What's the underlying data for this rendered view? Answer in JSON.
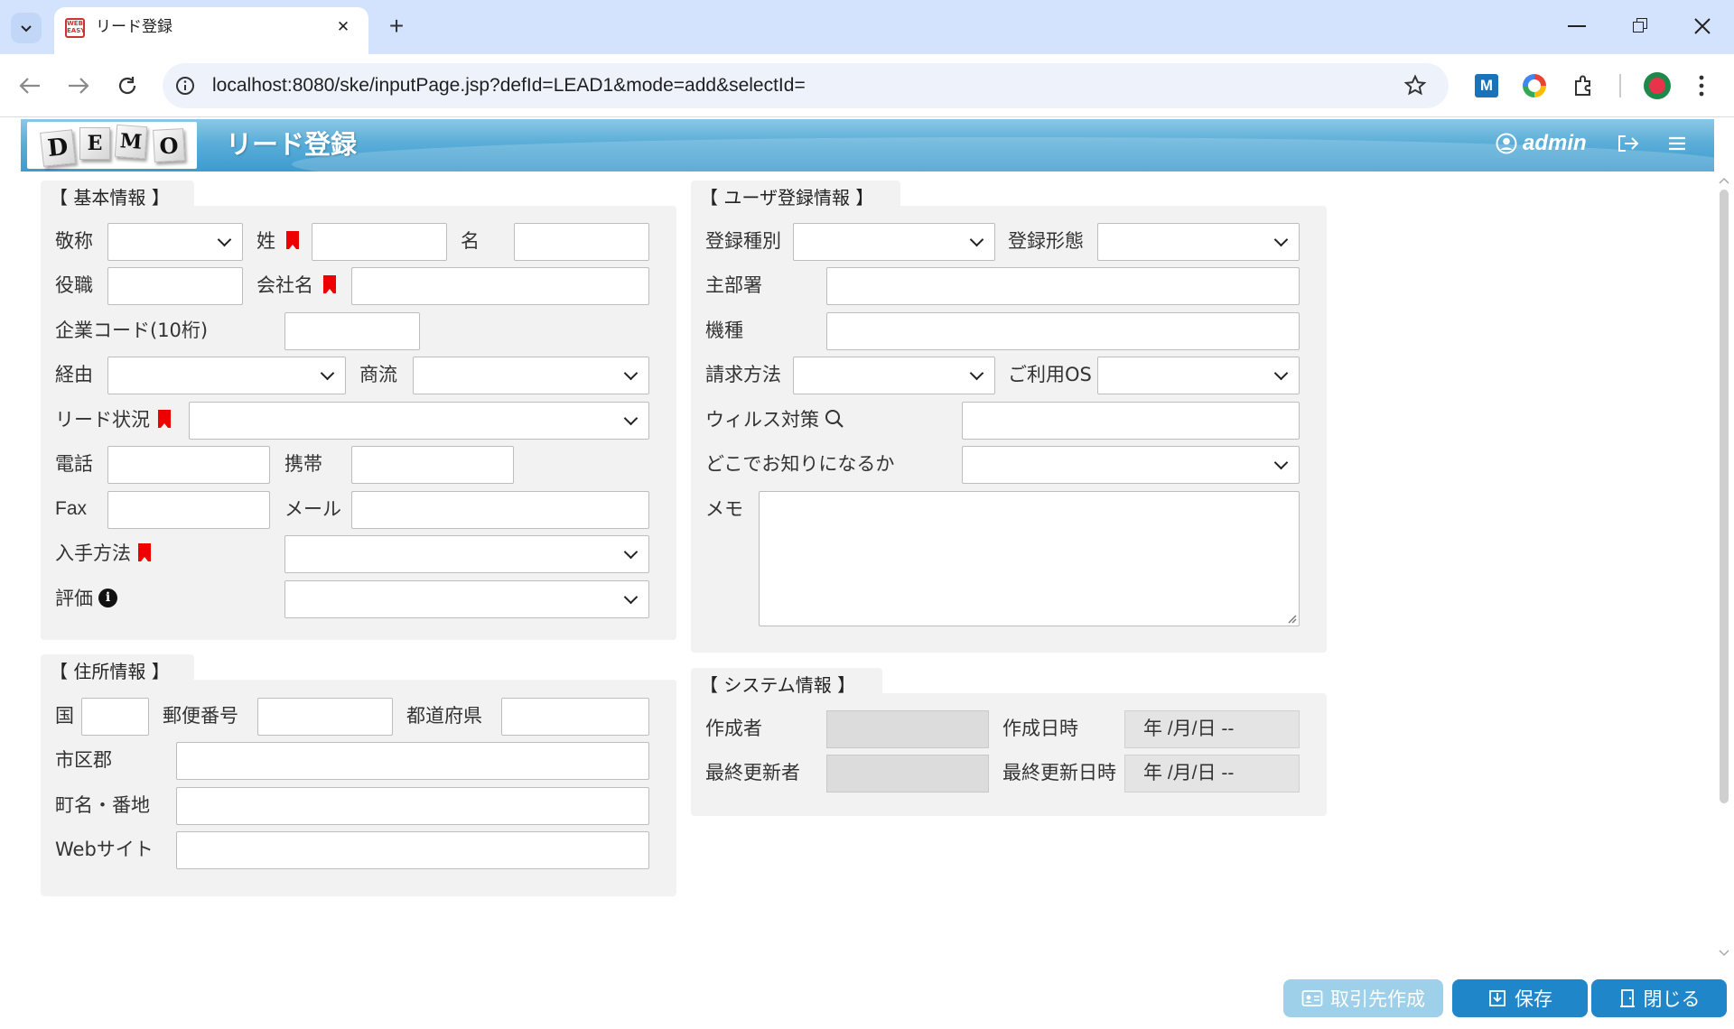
{
  "browser": {
    "tab_title": "リード登録",
    "url": "localhost:8080/ske/inputPage.jsp?defId=LEAD1&mode=add&selectId=",
    "new_tab_symbol": "+",
    "close_symbol": "✕"
  },
  "app": {
    "logo_letters": [
      "D",
      "E",
      "M",
      "O"
    ],
    "title": "リード登録",
    "user": "admin"
  },
  "basic": {
    "heading": "【 基本情報 】",
    "honorific": "敬称",
    "last_name": "姓",
    "first_name": "名",
    "position": "役職",
    "company": "会社名",
    "company_code": "企業コード(10桁)",
    "route": "経由",
    "distribution": "商流",
    "lead_status": "リード状況",
    "phone": "電話",
    "mobile": "携帯",
    "fax": "Fax",
    "mail": "メール",
    "acquisition": "入手方法",
    "rating": "評価",
    "info_glyph": "i"
  },
  "address": {
    "heading": "【 住所情報 】",
    "country": "国",
    "postal": "郵便番号",
    "prefecture": "都道府県",
    "city": "市区郡",
    "street": "町名・番地",
    "website": "Webサイト"
  },
  "user_reg": {
    "heading": "【 ユーザ登録情報 】",
    "reg_type": "登録種別",
    "reg_form": "登録形態",
    "main_dept": "主部署",
    "model": "機種",
    "billing": "請求方法",
    "os": "ご利用OS",
    "antivirus": "ウィルス対策",
    "source": "どこでお知りになるか",
    "memo": "メモ"
  },
  "system": {
    "heading": "【 システム情報 】",
    "creator": "作成者",
    "created_at": "作成日時",
    "updater": "最終更新者",
    "updated_at": "最終更新日時",
    "date_placeholder": "年 /月/日  --"
  },
  "buttons": {
    "create_partner": "取引先作成",
    "save": "保存",
    "close": "閉じる"
  },
  "colors": {
    "header_blue": "#3d9bd0",
    "required_red": "#ee0000",
    "button_blue": "#1f86c9",
    "button_disabled": "#9fd0ea"
  }
}
